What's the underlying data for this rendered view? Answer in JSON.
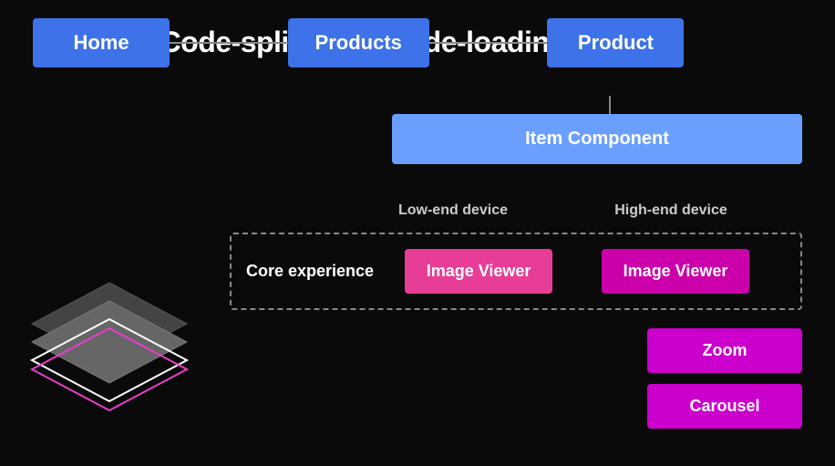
{
  "title": "Adaptive Code-splitting & Code-loading",
  "routes": [
    {
      "label": "Home"
    },
    {
      "label": "Products"
    },
    {
      "label": "Product"
    }
  ],
  "item_component": "Item Component",
  "devices": {
    "low": "Low-end device",
    "high": "High-end device"
  },
  "core_experience": "Core experience",
  "image_viewer": "Image Viewer",
  "zoom": "Zoom",
  "carousel": "Carousel"
}
